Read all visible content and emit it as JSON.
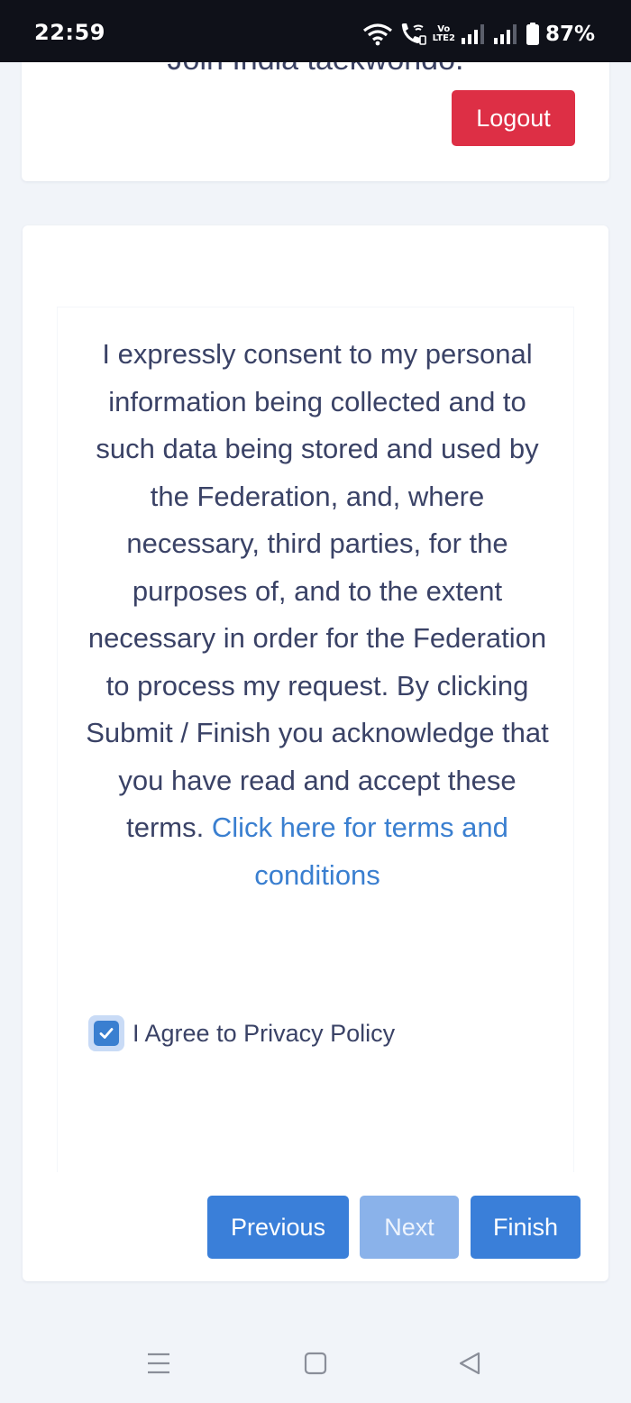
{
  "status_bar": {
    "time": "22:59",
    "battery_percent": "87%",
    "volte_label_top": "Vo",
    "volte_label_bottom": "LTE2",
    "icons": [
      "wifi-icon",
      "wifi-call-icon",
      "volte-icon",
      "signal-icon",
      "signal-icon",
      "battery-icon"
    ]
  },
  "top_card": {
    "cut_text": "Join India taekwondo.",
    "logout_label": "Logout",
    "logout_color": "#dd2f45"
  },
  "consent": {
    "text": "I expressly consent to my personal information being collected and to such data being stored and used by the Federation, and, where necessary, third parties, for the purposes of, and to the extent necessary in order for the Federation to process my request. By clicking Submit / Finish you acknowledge that you have read and accept these terms. ",
    "terms_link": "Click here for terms and conditions",
    "agree_label": "I Agree to Privacy Policy",
    "agree_checked": true
  },
  "wizard_buttons": {
    "previous": "Previous",
    "next": "Next",
    "finish": "Finish",
    "accent_color": "#3a7fd9",
    "next_disabled": true
  },
  "nav_bar": {
    "icons": [
      "menu-icon",
      "home-icon",
      "back-icon"
    ]
  }
}
